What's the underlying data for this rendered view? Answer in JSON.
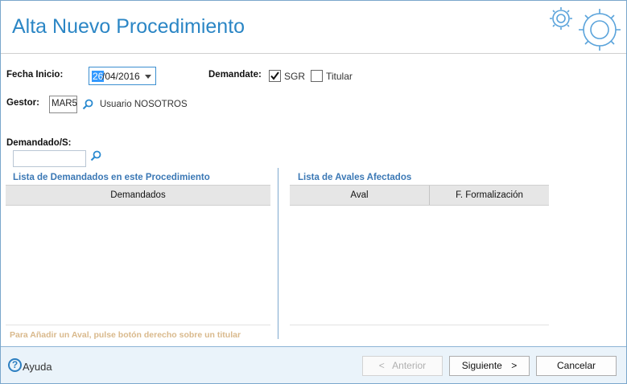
{
  "header": {
    "title": "Alta Nuevo Procedimiento"
  },
  "form": {
    "fecha_inicio_label": "Fecha Inicio:",
    "fecha_day_selected": "26",
    "fecha_rest": "/04/2016",
    "demandate_label": "Demandate:",
    "checkbox_sgr": {
      "label": "SGR",
      "checked": true
    },
    "checkbox_titular": {
      "label": "Titular",
      "checked": false
    },
    "gestor_label": "Gestor:",
    "gestor_code": "MAR5",
    "gestor_name": "Usuario NOSOTROS",
    "demandados_label": "Demandado/S:",
    "demandados_value": ""
  },
  "left_panel": {
    "title": "Lista de Demandados en este Procedimiento",
    "columns": [
      "Demandados"
    ],
    "rows": []
  },
  "right_panel": {
    "title": "Lista de Avales Afectados",
    "columns": [
      "Aval",
      "F. Formalización"
    ],
    "rows": []
  },
  "hint": "Para Añadir un Aval, pulse botón derecho sobre un titular",
  "footer": {
    "help_label": "Ayuda",
    "prev_label": "Anterior",
    "prev_arrow": "<",
    "next_label": "Siguiente",
    "next_arrow": ">",
    "cancel_label": "Cancelar"
  },
  "colors": {
    "accent": "#2b86c5",
    "section_title": "#3b78b5",
    "hint": "#d9b98c",
    "footer_bg": "#eaf3fa"
  }
}
